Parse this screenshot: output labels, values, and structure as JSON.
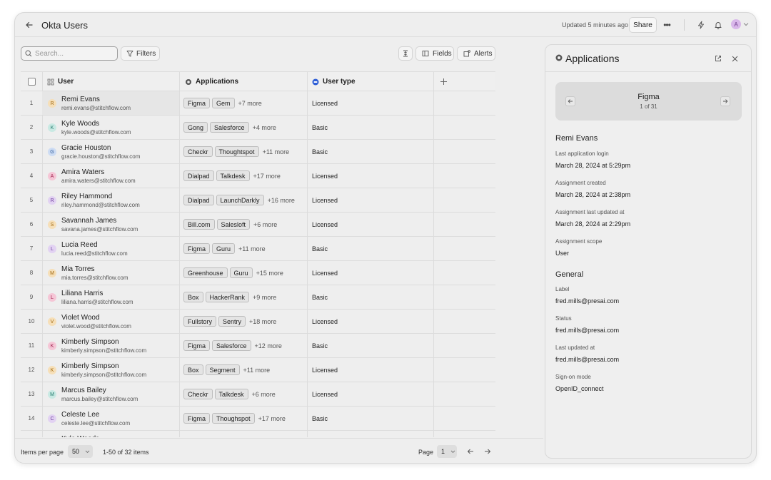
{
  "header": {
    "title": "Okta Users",
    "updated": "Updated 5 minutes ago",
    "share_label": "Share",
    "more_label": "•••",
    "avatar_initial": "A"
  },
  "toolbar": {
    "search_placeholder": "Search...",
    "filters_label": "Filters",
    "fields_label": "Fields",
    "alerts_label": "Alerts"
  },
  "table": {
    "columns": {
      "user": "User",
      "applications": "Applications",
      "user_type": "User type"
    },
    "rows": [
      {
        "num": "1",
        "initial": "R",
        "name": "Remi Evans",
        "email": "remi.evans@stitchflow.com",
        "apps": [
          "Figma",
          "Gem"
        ],
        "more": "+7 more",
        "type": "Licensed",
        "avatar_bg": "#f6dfb8",
        "avatar_fg": "#a0680f"
      },
      {
        "num": "2",
        "initial": "K",
        "name": "Kyle Woods",
        "email": "kyle.woods@stitchflow.com",
        "apps": [
          "Gong",
          "Salesforce"
        ],
        "more": "+4 more",
        "type": "Basic",
        "avatar_bg": "#c9e9e3",
        "avatar_fg": "#237a6c"
      },
      {
        "num": "3",
        "initial": "G",
        "name": "Gracie Houston",
        "email": "gracie.houston@stitchflow.com",
        "apps": [
          "Checkr",
          "Thoughtspot"
        ],
        "more": "+11 more",
        "type": "Basic",
        "avatar_bg": "#cddcf3",
        "avatar_fg": "#2e5a9a"
      },
      {
        "num": "4",
        "initial": "A",
        "name": "Amira Waters",
        "email": "amira.waters@stitchflow.com",
        "apps": [
          "Dialpad",
          "Talkdesk"
        ],
        "more": "+17 more",
        "type": "Licensed",
        "avatar_bg": "#f5c6d6",
        "avatar_fg": "#a0234f"
      },
      {
        "num": "5",
        "initial": "R",
        "name": "Riley Hammond",
        "email": "riley.hammond@stitchflow.com",
        "apps": [
          "Dialpad",
          "LaunchDarkly"
        ],
        "more": "+16 more",
        "type": "Licensed",
        "avatar_bg": "#e2d2f2",
        "avatar_fg": "#6b3a9a"
      },
      {
        "num": "6",
        "initial": "S",
        "name": "Savannah James",
        "email": "savana.james@stitchflow.com",
        "apps": [
          "Bill.com",
          "Salesloft"
        ],
        "more": "+6 more",
        "type": "Licensed",
        "avatar_bg": "#f6dfb8",
        "avatar_fg": "#a0680f"
      },
      {
        "num": "7",
        "initial": "L",
        "name": "Lucia Reed",
        "email": "lucia.reed@stitchflow.com",
        "apps": [
          "Figma",
          "Guru"
        ],
        "more": "+11 more",
        "type": "Basic",
        "avatar_bg": "#e2d2f2",
        "avatar_fg": "#6b3a9a"
      },
      {
        "num": "8",
        "initial": "M",
        "name": "Mia Torres",
        "email": "mia.torres@stitchflow.com",
        "apps": [
          "Greenhouse",
          "Guru"
        ],
        "more": "+15 more",
        "type": "Licensed",
        "avatar_bg": "#f6dfb8",
        "avatar_fg": "#a0680f"
      },
      {
        "num": "9",
        "initial": "L",
        "name": "Liliana Harris",
        "email": "liliana.harris@stitchflow.com",
        "apps": [
          "Box",
          "HackerRank"
        ],
        "more": "+9 more",
        "type": "Basic",
        "avatar_bg": "#f5c6d6",
        "avatar_fg": "#a0234f"
      },
      {
        "num": "10",
        "initial": "V",
        "name": "Violet Wood",
        "email": "violet.wood@stitchflow.com",
        "apps": [
          "Fullstory",
          "Sentry"
        ],
        "more": "+18 more",
        "type": "Licensed",
        "avatar_bg": "#f6dfb8",
        "avatar_fg": "#a0680f"
      },
      {
        "num": "11",
        "initial": "K",
        "name": "Kimberly Simpson",
        "email": "kimberly.simpson@stitchflow.com",
        "apps": [
          "Figma",
          "Salesforce"
        ],
        "more": "+12 more",
        "type": "Basic",
        "avatar_bg": "#f5c6d6",
        "avatar_fg": "#a0234f"
      },
      {
        "num": "12",
        "initial": "K",
        "name": "Kimberly Simpson",
        "email": "kimberly.simpson@stitchflow.com",
        "apps": [
          "Box",
          "Segment"
        ],
        "more": "+11 more",
        "type": "Licensed",
        "avatar_bg": "#f6dfb8",
        "avatar_fg": "#a0680f"
      },
      {
        "num": "13",
        "initial": "M",
        "name": "Marcus Bailey",
        "email": "marcus.bailey@stitchflow.com",
        "apps": [
          "Checkr",
          "Talkdesk"
        ],
        "more": "+6 more",
        "type": "Licensed",
        "avatar_bg": "#c9e9e3",
        "avatar_fg": "#237a6c"
      },
      {
        "num": "14",
        "initial": "C",
        "name": "Celeste Lee",
        "email": "celeste.lee@stitchflow.com",
        "apps": [
          "Figma",
          "Thoughspot"
        ],
        "more": "+17 more",
        "type": "Basic",
        "avatar_bg": "#e2d2f2",
        "avatar_fg": "#6b3a9a"
      },
      {
        "num": "",
        "initial": "",
        "name": "Kyle Woods",
        "email": "",
        "apps": [],
        "more": "",
        "type": "",
        "avatar_bg": "#cddcf3",
        "avatar_fg": "#2e5a9a"
      }
    ]
  },
  "footer": {
    "items_per_page_label": "Items per page",
    "items_per_page_value": "50",
    "range_text": "1-50 of 32 items",
    "page_label": "Page",
    "page_value": "1"
  },
  "panel": {
    "title": "Applications",
    "carousel": {
      "title": "Figma",
      "subtitle": "1 of 31"
    },
    "user_name": "Remi Evans",
    "details": [
      {
        "label": "Last application login",
        "value": "March 28, 2024 at 5:29pm"
      },
      {
        "label": "Assignment created",
        "value": "March 28, 2024 at 2:38pm"
      },
      {
        "label": "Assignment last updated at",
        "value": "March 28, 2024 at 2:29pm"
      },
      {
        "label": "Assignment scope",
        "value": "User"
      }
    ],
    "general_title": "General",
    "general": [
      {
        "label": "Label",
        "value": "fred.mills@presai.com"
      },
      {
        "label": "Status",
        "value": "fred.mills@presai.com"
      },
      {
        "label": "Last updated at",
        "value": "fred.mills@presai.com"
      },
      {
        "label": "Sign-on mode",
        "value": "OpenID_connect"
      }
    ]
  },
  "colors": {
    "user_type_icon": "#2f5fd6",
    "accent_avatar": "#d9b7ea"
  }
}
